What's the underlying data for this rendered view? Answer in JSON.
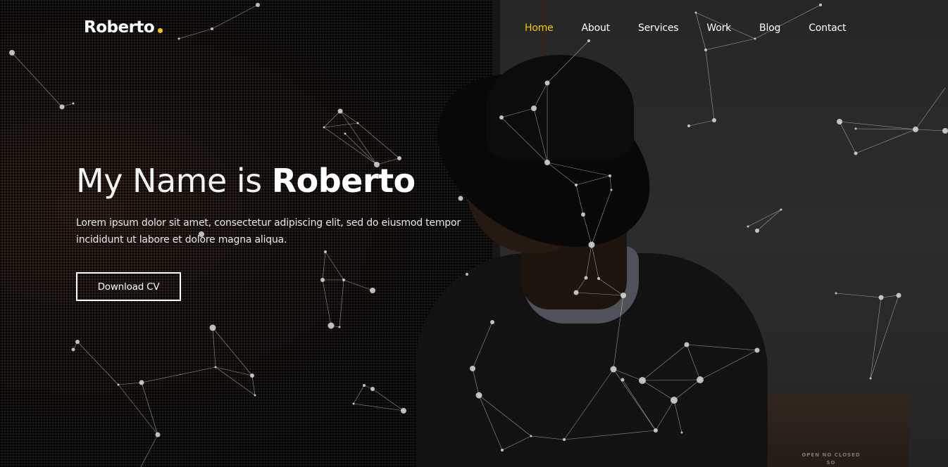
{
  "brand": {
    "name": "Roberto",
    "dot_color": "#f7c600"
  },
  "nav": {
    "items": [
      {
        "label": "Home",
        "active": true
      },
      {
        "label": "About",
        "active": false
      },
      {
        "label": "Services",
        "active": false
      },
      {
        "label": "Work",
        "active": false
      },
      {
        "label": "Blog",
        "active": false
      },
      {
        "label": "Contact",
        "active": false
      }
    ],
    "active_color": "#f7c600"
  },
  "hero": {
    "heading_light": "My Name is ",
    "heading_bold": "Roberto",
    "description": "Lorem ipsum dolor sit amet, consectetur adipiscing elit, sed do eiusmod tempor incididunt ut labore et dolore magna aliqua.",
    "cta_label": "Download CV"
  },
  "background": {
    "sign_text": "OPEN NO CLOSED SO"
  }
}
